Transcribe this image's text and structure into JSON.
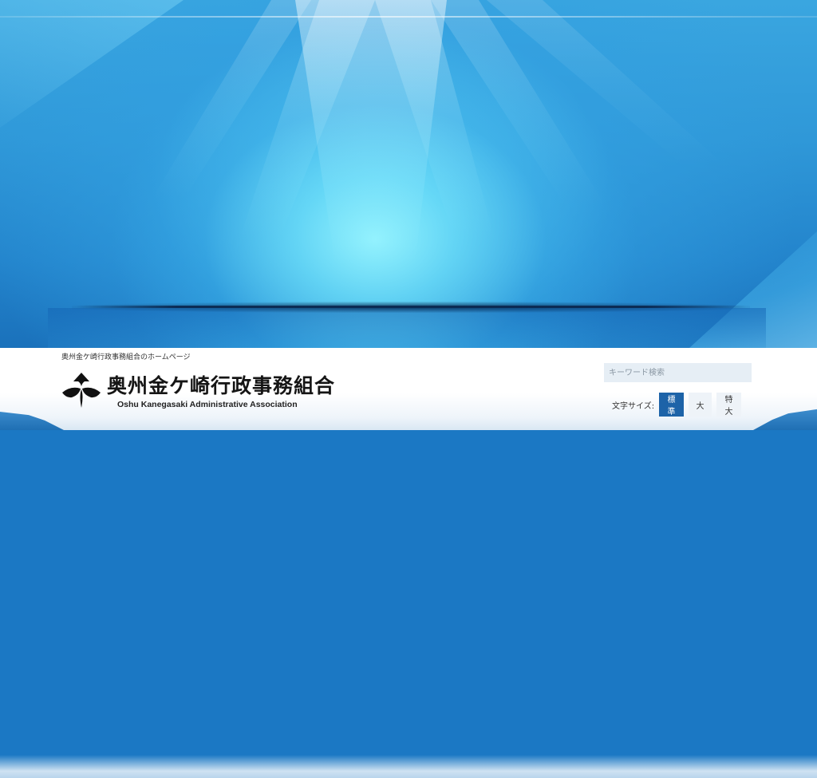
{
  "header": {
    "tagline": "奥州金ケ崎行政事務組合のホームページ",
    "title": "奥州金ケ崎行政事務組合",
    "subtitle": "Oshu Kanegasaki Administrative Association",
    "logo_icon": "emblem-icon"
  },
  "search": {
    "placeholder": "キーワード検索",
    "value": ""
  },
  "font_size": {
    "label": "文字サイズ:",
    "options": [
      "標準",
      "大",
      "特大"
    ],
    "selected": "標準"
  },
  "colors": {
    "hero_light": "#9af5ff",
    "hero_dark": "#1a71bb",
    "selected_button": "#1d63a8",
    "button_bg": "#eef3f8"
  }
}
